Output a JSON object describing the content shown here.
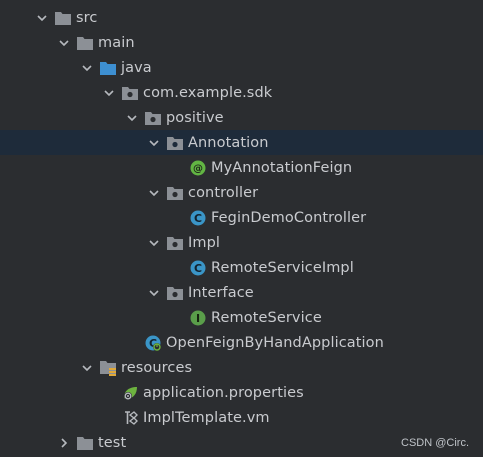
{
  "tree": {
    "items": [
      {
        "label": "src",
        "icon": "folder-icon"
      },
      {
        "label": "main",
        "icon": "folder-icon"
      },
      {
        "label": "java",
        "icon": "source-folder-icon"
      },
      {
        "label": "com.example.sdk",
        "icon": "package-icon"
      },
      {
        "label": "positive",
        "icon": "package-icon"
      },
      {
        "label": "Annotation",
        "icon": "package-icon",
        "selected": true
      },
      {
        "label": "MyAnnotationFeign",
        "icon": "annotation-icon"
      },
      {
        "label": "controller",
        "icon": "package-icon"
      },
      {
        "label": "FeginDemoController",
        "icon": "class-icon"
      },
      {
        "label": "Impl",
        "icon": "package-icon"
      },
      {
        "label": "RemoteServiceImpl",
        "icon": "class-icon"
      },
      {
        "label": "Interface",
        "icon": "package-icon"
      },
      {
        "label": "RemoteService",
        "icon": "interface-icon"
      },
      {
        "label": "OpenFeignByHandApplication",
        "icon": "spring-boot-class-icon"
      },
      {
        "label": "resources",
        "icon": "resources-folder-icon"
      },
      {
        "label": "application.properties",
        "icon": "spring-properties-icon"
      },
      {
        "label": "ImplTemplate.vm",
        "icon": "velocity-template-icon"
      },
      {
        "label": "test",
        "icon": "folder-icon"
      }
    ]
  },
  "watermark": "CSDN @Circ.",
  "colors": {
    "background": "#2b2d30",
    "selected_row": "#1e2b3a",
    "text": "#c9cbcf",
    "folder": "#8c9096",
    "source_folder": "#3d8fd1",
    "class": "#3a95c7",
    "interface": "#5a9e4a",
    "annotation": "#62b543"
  }
}
